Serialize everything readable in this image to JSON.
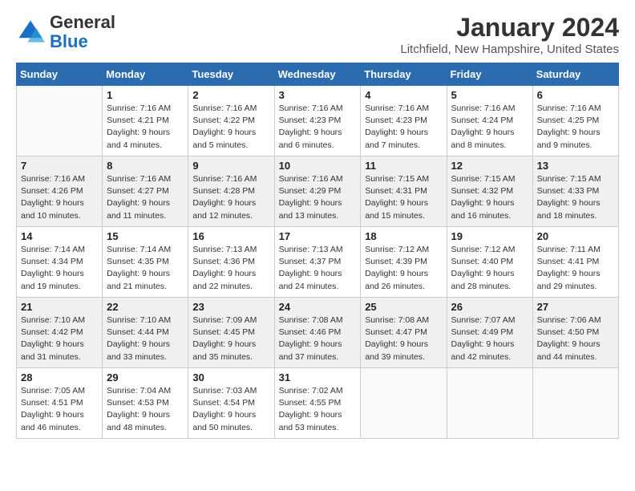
{
  "header": {
    "logo_general": "General",
    "logo_blue": "Blue",
    "month_title": "January 2024",
    "location": "Litchfield, New Hampshire, United States"
  },
  "columns": [
    "Sunday",
    "Monday",
    "Tuesday",
    "Wednesday",
    "Thursday",
    "Friday",
    "Saturday"
  ],
  "weeks": [
    {
      "shaded": false,
      "days": [
        {
          "num": "",
          "info": ""
        },
        {
          "num": "1",
          "info": "Sunrise: 7:16 AM\nSunset: 4:21 PM\nDaylight: 9 hours\nand 4 minutes."
        },
        {
          "num": "2",
          "info": "Sunrise: 7:16 AM\nSunset: 4:22 PM\nDaylight: 9 hours\nand 5 minutes."
        },
        {
          "num": "3",
          "info": "Sunrise: 7:16 AM\nSunset: 4:23 PM\nDaylight: 9 hours\nand 6 minutes."
        },
        {
          "num": "4",
          "info": "Sunrise: 7:16 AM\nSunset: 4:23 PM\nDaylight: 9 hours\nand 7 minutes."
        },
        {
          "num": "5",
          "info": "Sunrise: 7:16 AM\nSunset: 4:24 PM\nDaylight: 9 hours\nand 8 minutes."
        },
        {
          "num": "6",
          "info": "Sunrise: 7:16 AM\nSunset: 4:25 PM\nDaylight: 9 hours\nand 9 minutes."
        }
      ]
    },
    {
      "shaded": true,
      "days": [
        {
          "num": "7",
          "info": "Sunrise: 7:16 AM\nSunset: 4:26 PM\nDaylight: 9 hours\nand 10 minutes."
        },
        {
          "num": "8",
          "info": "Sunrise: 7:16 AM\nSunset: 4:27 PM\nDaylight: 9 hours\nand 11 minutes."
        },
        {
          "num": "9",
          "info": "Sunrise: 7:16 AM\nSunset: 4:28 PM\nDaylight: 9 hours\nand 12 minutes."
        },
        {
          "num": "10",
          "info": "Sunrise: 7:16 AM\nSunset: 4:29 PM\nDaylight: 9 hours\nand 13 minutes."
        },
        {
          "num": "11",
          "info": "Sunrise: 7:15 AM\nSunset: 4:31 PM\nDaylight: 9 hours\nand 15 minutes."
        },
        {
          "num": "12",
          "info": "Sunrise: 7:15 AM\nSunset: 4:32 PM\nDaylight: 9 hours\nand 16 minutes."
        },
        {
          "num": "13",
          "info": "Sunrise: 7:15 AM\nSunset: 4:33 PM\nDaylight: 9 hours\nand 18 minutes."
        }
      ]
    },
    {
      "shaded": false,
      "days": [
        {
          "num": "14",
          "info": "Sunrise: 7:14 AM\nSunset: 4:34 PM\nDaylight: 9 hours\nand 19 minutes."
        },
        {
          "num": "15",
          "info": "Sunrise: 7:14 AM\nSunset: 4:35 PM\nDaylight: 9 hours\nand 21 minutes."
        },
        {
          "num": "16",
          "info": "Sunrise: 7:13 AM\nSunset: 4:36 PM\nDaylight: 9 hours\nand 22 minutes."
        },
        {
          "num": "17",
          "info": "Sunrise: 7:13 AM\nSunset: 4:37 PM\nDaylight: 9 hours\nand 24 minutes."
        },
        {
          "num": "18",
          "info": "Sunrise: 7:12 AM\nSunset: 4:39 PM\nDaylight: 9 hours\nand 26 minutes."
        },
        {
          "num": "19",
          "info": "Sunrise: 7:12 AM\nSunset: 4:40 PM\nDaylight: 9 hours\nand 28 minutes."
        },
        {
          "num": "20",
          "info": "Sunrise: 7:11 AM\nSunset: 4:41 PM\nDaylight: 9 hours\nand 29 minutes."
        }
      ]
    },
    {
      "shaded": true,
      "days": [
        {
          "num": "21",
          "info": "Sunrise: 7:10 AM\nSunset: 4:42 PM\nDaylight: 9 hours\nand 31 minutes."
        },
        {
          "num": "22",
          "info": "Sunrise: 7:10 AM\nSunset: 4:44 PM\nDaylight: 9 hours\nand 33 minutes."
        },
        {
          "num": "23",
          "info": "Sunrise: 7:09 AM\nSunset: 4:45 PM\nDaylight: 9 hours\nand 35 minutes."
        },
        {
          "num": "24",
          "info": "Sunrise: 7:08 AM\nSunset: 4:46 PM\nDaylight: 9 hours\nand 37 minutes."
        },
        {
          "num": "25",
          "info": "Sunrise: 7:08 AM\nSunset: 4:47 PM\nDaylight: 9 hours\nand 39 minutes."
        },
        {
          "num": "26",
          "info": "Sunrise: 7:07 AM\nSunset: 4:49 PM\nDaylight: 9 hours\nand 42 minutes."
        },
        {
          "num": "27",
          "info": "Sunrise: 7:06 AM\nSunset: 4:50 PM\nDaylight: 9 hours\nand 44 minutes."
        }
      ]
    },
    {
      "shaded": false,
      "days": [
        {
          "num": "28",
          "info": "Sunrise: 7:05 AM\nSunset: 4:51 PM\nDaylight: 9 hours\nand 46 minutes."
        },
        {
          "num": "29",
          "info": "Sunrise: 7:04 AM\nSunset: 4:53 PM\nDaylight: 9 hours\nand 48 minutes."
        },
        {
          "num": "30",
          "info": "Sunrise: 7:03 AM\nSunset: 4:54 PM\nDaylight: 9 hours\nand 50 minutes."
        },
        {
          "num": "31",
          "info": "Sunrise: 7:02 AM\nSunset: 4:55 PM\nDaylight: 9 hours\nand 53 minutes."
        },
        {
          "num": "",
          "info": ""
        },
        {
          "num": "",
          "info": ""
        },
        {
          "num": "",
          "info": ""
        }
      ]
    }
  ]
}
